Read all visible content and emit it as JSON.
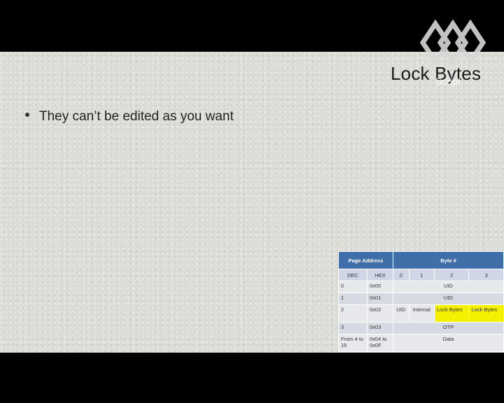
{
  "slide": {
    "title": "Lock Bytes",
    "overlay_text": "Script",
    "bullet": "They can’t be edited as you want"
  },
  "table": {
    "header": {
      "page_address": "Page Address",
      "byte": "Byte #"
    },
    "subheader": [
      "DEC",
      "HEX",
      "0",
      "1",
      "2",
      "3"
    ],
    "rows": [
      {
        "dec": "0",
        "hex": "0x00",
        "span": "UID"
      },
      {
        "dec": "1",
        "hex": "0x01",
        "span": "UID"
      },
      {
        "dec": "2",
        "hex": "0x02",
        "b0": "UID",
        "b1": "Internal",
        "b2": "Lock Bytes",
        "b3": "Lock Bytes"
      },
      {
        "dec": "3",
        "hex": "0x03",
        "span": "OTP"
      },
      {
        "dec": "From 4 to 15",
        "hex": "0x04 to 0x0F",
        "span": "Data"
      }
    ]
  },
  "colors": {
    "header_blue": "#3f6ea8",
    "highlight": "#f5f000",
    "letterbox": "#000000"
  },
  "logo": "diamond-logo-icon"
}
